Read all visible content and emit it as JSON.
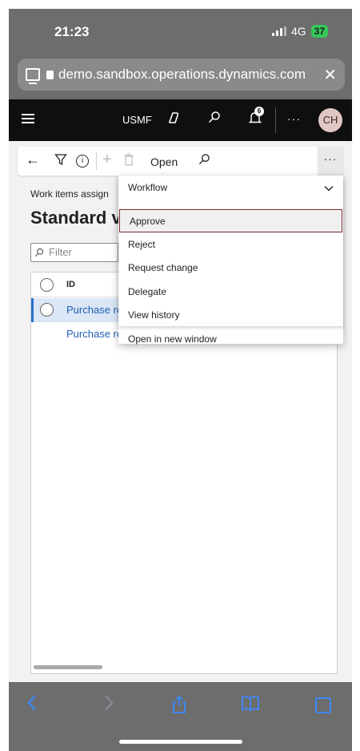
{
  "status": {
    "time": "21:23",
    "network": "4G",
    "battery": "37"
  },
  "browser": {
    "url": "demo.sandbox.operations.dynamics.com",
    "close_glyph": "✕"
  },
  "header": {
    "company": "USMF",
    "notification_count": "6",
    "more_glyph": "···",
    "avatar_initials": "CH"
  },
  "actionbar": {
    "open_label": "Open",
    "more_glyph": "···"
  },
  "page": {
    "subtitle": "Work items assign",
    "title": "Standard v",
    "filter_placeholder": "Filter"
  },
  "grid": {
    "columns": [
      "ID"
    ],
    "rows": [
      {
        "id": "Purchase re",
        "selected": true
      },
      {
        "id": "Purchase re",
        "selected": false
      }
    ]
  },
  "menu": {
    "group_label": "Workflow",
    "items": [
      "Approve",
      "Reject",
      "Request change",
      "Delegate",
      "View history"
    ],
    "active_item": "Approve",
    "extra_item": "Open in new window"
  },
  "colors": {
    "accent": "#2e6fcf",
    "active_border": "#7b2a2f",
    "safari_blue": "#3b89ff"
  }
}
